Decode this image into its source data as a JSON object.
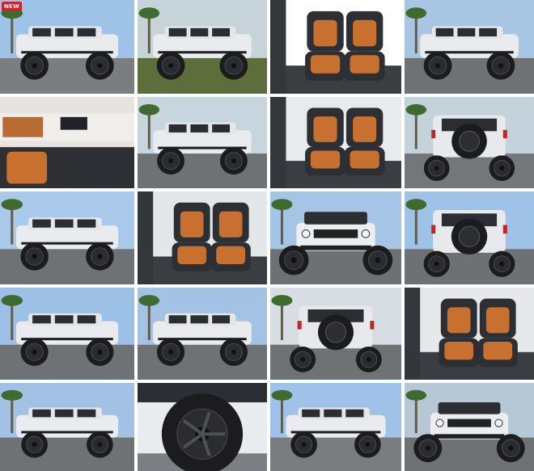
{
  "gallery": {
    "badge_label": "NEW",
    "photos": [
      {
        "kind": "exterior-side",
        "sky": "#9fc3e6",
        "ground": "#7b7e80"
      },
      {
        "kind": "exterior-side",
        "sky": "#c6d4d9",
        "ground": "#5d6e3c"
      },
      {
        "kind": "interior-seats",
        "sky": "#ffffff",
        "ground": "#3a3d41"
      },
      {
        "kind": "exterior-front-angle",
        "sky": "#a8c6e4",
        "ground": "#6f7275"
      },
      {
        "kind": "interior-dash",
        "sky": "#e7e4df",
        "ground": "#2e3033"
      },
      {
        "kind": "exterior-side",
        "sky": "#c7d5de",
        "ground": "#6f7275"
      },
      {
        "kind": "interior-seats",
        "sky": "#e8ebee",
        "ground": "#3a3d41"
      },
      {
        "kind": "exterior-rear",
        "sky": "#c4d2dc",
        "ground": "#74777a"
      },
      {
        "kind": "exterior-side",
        "sky": "#a9c9ea",
        "ground": "#6f7275"
      },
      {
        "kind": "interior-seats",
        "sky": "#e4e7ea",
        "ground": "#3a3d41"
      },
      {
        "kind": "exterior-front",
        "sky": "#a5c5e6",
        "ground": "#6e7174"
      },
      {
        "kind": "exterior-rear",
        "sky": "#9fc2e7",
        "ground": "#6e7174"
      },
      {
        "kind": "exterior-side",
        "sky": "#9dc0e6",
        "ground": "#6f7275"
      },
      {
        "kind": "exterior-front-angle",
        "sky": "#a4c3e4",
        "ground": "#6f7275"
      },
      {
        "kind": "exterior-rear",
        "sky": "#d7dde2",
        "ground": "#6f7275"
      },
      {
        "kind": "interior-seats",
        "sky": "#e6e8ea",
        "ground": "#3a3d41"
      },
      {
        "kind": "exterior-front-angle",
        "sky": "#a2c2e5",
        "ground": "#6f7275"
      },
      {
        "kind": "wheel-closeup",
        "sky": "#e9ecef",
        "ground": "#7c7f83"
      },
      {
        "kind": "exterior-side",
        "sky": "#a0c2e8",
        "ground": "#7a7d80"
      },
      {
        "kind": "exterior-front",
        "sky": "#b6c7d6",
        "ground": "#6f7275"
      }
    ]
  }
}
